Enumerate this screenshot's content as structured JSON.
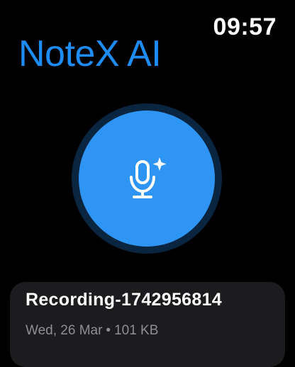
{
  "status": {
    "time": "09:57"
  },
  "app": {
    "title": "NoteX AI"
  },
  "record_button": {
    "icon": "microphone-sparkle-icon",
    "color": "#2f95f5",
    "ring_color": "#0a2540"
  },
  "recordings": [
    {
      "name": "Recording-1742956814",
      "date": "Wed, 26 Mar",
      "separator": "•",
      "size": "101 KB"
    }
  ],
  "colors": {
    "accent": "#1e8cf5",
    "card_background": "#1c1c1e",
    "secondary_text": "#8e8e93"
  }
}
